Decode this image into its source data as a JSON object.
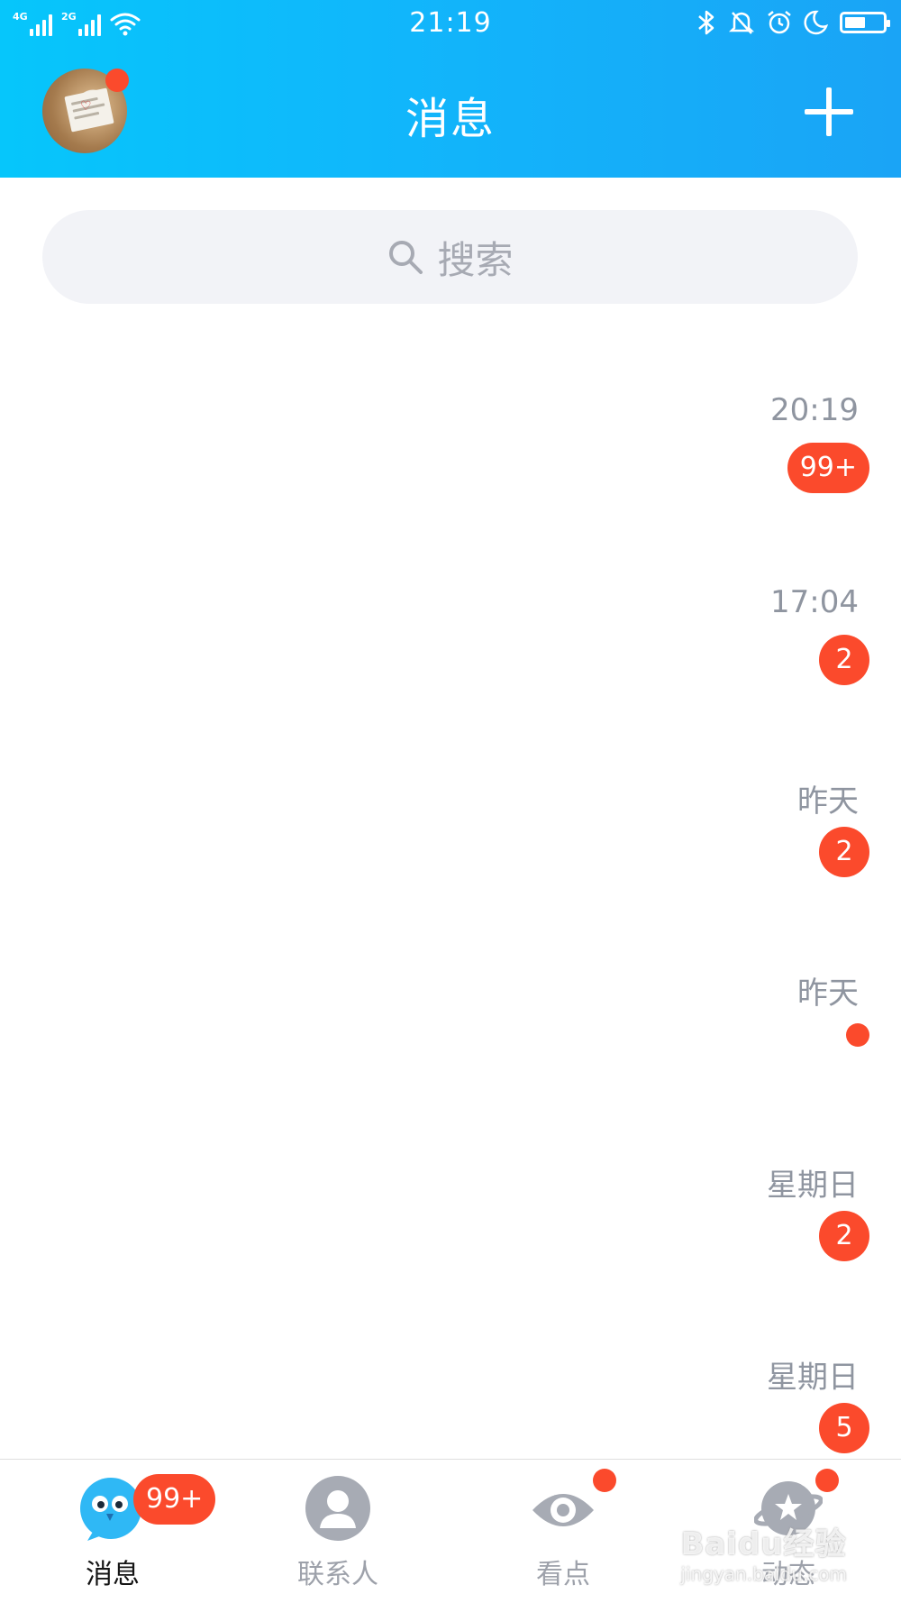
{
  "status_bar": {
    "time": "21:19",
    "network_1": "4G",
    "network_2": "2G",
    "battery_level": 0.55,
    "icons": [
      "signal-icon",
      "wifi-icon",
      "bluetooth-icon",
      "mute-icon",
      "alarm-icon",
      "do-not-disturb-icon",
      "battery-icon"
    ]
  },
  "header": {
    "title": "消息",
    "avatar_has_notification": true,
    "add_icon": "plus-icon"
  },
  "search": {
    "placeholder": "搜索",
    "icon": "search-icon"
  },
  "conversations": [
    {
      "time": "20:19",
      "unread": "99+"
    },
    {
      "time": "17:04",
      "unread": "2"
    },
    {
      "time": "昨天",
      "unread": "2"
    },
    {
      "time": "昨天",
      "unread": ""
    },
    {
      "time": "星期日",
      "unread": "2"
    },
    {
      "time": "星期日",
      "unread": "5"
    }
  ],
  "tabbar": {
    "tabs": [
      {
        "label": "消息",
        "icon": "message-penguin-icon",
        "active": true,
        "badge": "99+"
      },
      {
        "label": "联系人",
        "icon": "contacts-icon",
        "active": false
      },
      {
        "label": "看点",
        "icon": "eye-icon",
        "active": false
      },
      {
        "label": "动态",
        "icon": "planet-star-icon",
        "active": false
      }
    ]
  },
  "watermark": {
    "text": "Baidu经验",
    "sub": "jingyan.baidu.com"
  },
  "colors": {
    "header_start": "#06c6fb",
    "header_end": "#1aa4f6",
    "badge": "#fb4a2c",
    "search_bg": "#f2f3f7",
    "muted_text": "#8f95a0"
  }
}
